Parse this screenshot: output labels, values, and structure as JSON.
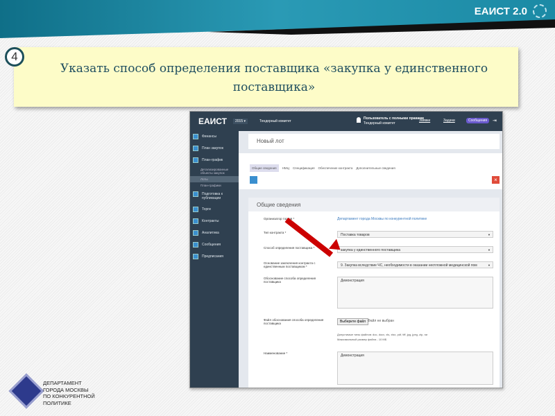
{
  "brand": "ЕАИСТ 2.0",
  "step_number": "4",
  "instruction": "Указать способ определения поставщика «закупка у единственного поставщика»",
  "department": [
    "ДЕПАРТАМЕНТ",
    "ГОРОДА МОСКВЫ",
    "ПО КОНКУРЕНТНОЙ",
    "ПОЛИТИКЕ"
  ],
  "app": {
    "logo": "ЕАИСТ",
    "year": "2015 ▾",
    "committee": "Тендерный комитет",
    "user": "Пользователь с полными правами",
    "user_org": "Тендерный комитет",
    "links": [
      "Заявки",
      "Задачи",
      "Сообщения"
    ],
    "sidebar": [
      {
        "label": "Финансы"
      },
      {
        "label": "План закупок"
      },
      {
        "label": "План-график"
      }
    ],
    "sidebar_sub": [
      "Детализированные объекты закупок",
      "Лоты",
      "План-графики"
    ],
    "sidebar_more": [
      "Подготовка к публикации",
      "Торги",
      "Контракты",
      "Аналитика",
      "Сообщения",
      "Предписания"
    ],
    "page_title": "Новый лот",
    "tabs": [
      "Общие сведения",
      "НМЦ",
      "Спецификация",
      "Обеспечение контракта",
      "Дополнительные сведения"
    ],
    "section_title": "Общие сведения",
    "fields": {
      "organizer_label": "Организатор торгов *",
      "organizer_value": "Департамент города Москвы по конкурентной политике",
      "contract_type_label": "Тип контракта *",
      "contract_type_value": "Поставка товаров",
      "method_label": "Способ определения поставщика *",
      "method_value": "закупка у единственного поставщика",
      "basis_label": "Основание заключения контракта с единственным поставщиком *",
      "basis_value": "9. Закупка вследствие ЧС, необходимости в оказании неотложной медицинской пом",
      "justification_label": "Обоснование способа определения поставщика",
      "justification_value": "Демонстрация",
      "file_label": "Файл обоснования способа определения поставщика",
      "file_button": "Выберите файл",
      "file_status": "Файл не выбран",
      "file_types": "Допустимые типы файлов: doc, docx, xls, xlsx, pdf, tiff, jpg, jpeg, zip, rar",
      "file_size": "Максимальный размер файла - 10 МБ",
      "name_label": "Наименование *",
      "name_value": "Демонстрация"
    }
  }
}
